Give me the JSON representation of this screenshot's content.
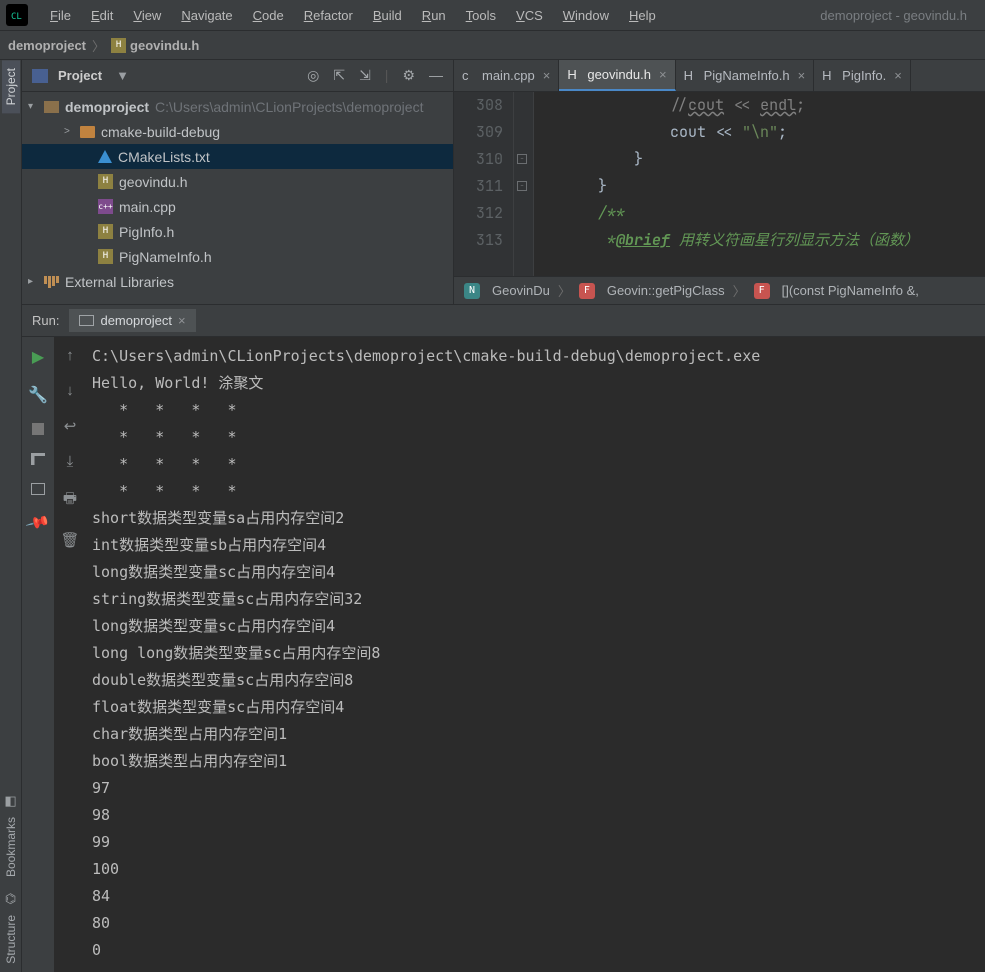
{
  "window_title": "demoproject - geovindu.h",
  "menu": [
    "File",
    "Edit",
    "View",
    "Navigate",
    "Code",
    "Refactor",
    "Build",
    "Run",
    "Tools",
    "VCS",
    "Window",
    "Help"
  ],
  "breadcrumb": {
    "project": "demoproject",
    "file": "geovindu.h"
  },
  "project_panel": {
    "title": "Project",
    "root": {
      "name": "demoproject",
      "path": "C:\\Users\\admin\\CLionProjects\\demoproject"
    },
    "items": [
      {
        "type": "folder",
        "name": "cmake-build-debug",
        "indent": 2,
        "arrow": ">"
      },
      {
        "type": "cmake",
        "name": "CMakeLists.txt",
        "indent": 3,
        "selected": true
      },
      {
        "type": "h",
        "name": "geovindu.h",
        "indent": 3
      },
      {
        "type": "cpp",
        "name": "main.cpp",
        "indent": 3
      },
      {
        "type": "h",
        "name": "PigInfo.h",
        "indent": 3
      },
      {
        "type": "h",
        "name": "PigNameInfo.h",
        "indent": 3
      }
    ],
    "ext_libs": "External Libraries"
  },
  "editor_tabs": [
    {
      "icon": "cpp",
      "label": "main.cpp",
      "active": false
    },
    {
      "icon": "h",
      "label": "geovindu.h",
      "active": true
    },
    {
      "icon": "h",
      "label": "PigNameInfo.h",
      "active": false
    },
    {
      "icon": "h",
      "label": "PigInfo.",
      "active": false
    }
  ],
  "code": {
    "lines": [
      {
        "num": 308,
        "html": "//<u class='squiggle'>cout</u> << <u class='squiggle'>endl</u>;",
        "cls": "cmt",
        "pad": "            "
      },
      {
        "num": 309,
        "html": "cout << <span class='str'>\"\\n\"</span>;",
        "cls": "",
        "pad": "            "
      },
      {
        "num": 310,
        "html": "}",
        "cls": "brace",
        "pad": "        "
      },
      {
        "num": 311,
        "html": "}",
        "cls": "brace",
        "pad": "    "
      },
      {
        "num": 312,
        "html": "/**",
        "cls": "doccmt",
        "pad": "    "
      },
      {
        "num": 313,
        "html": "*<span class='doctag'>@brief</span> 用转义符画星行列显示方法（函数）",
        "cls": "doccmt",
        "pad": "     "
      }
    ],
    "fold_marks": [
      {
        "line": 310
      },
      {
        "line": 311
      }
    ]
  },
  "editor_crumbs": [
    {
      "badge": "n",
      "label": "GeovinDu"
    },
    {
      "badge": "f",
      "label": "Geovin::getPigClass"
    },
    {
      "badge": "f",
      "label": "[](const PigNameInfo &,"
    }
  ],
  "run": {
    "label": "Run:",
    "config": "demoproject",
    "output": [
      "C:\\Users\\admin\\CLionProjects\\demoproject\\cmake-build-debug\\demoproject.exe",
      "Hello, World! 涂聚文",
      "   *   *   *   *",
      "   *   *   *   *",
      "   *   *   *   *",
      "   *   *   *   *",
      "short数据类型变量sa占用内存空间2",
      "int数据类型变量sb占用内存空间4",
      "long数据类型变量sc占用内存空间4",
      "string数据类型变量sc占用内存空间32",
      "long数据类型变量sc占用内存空间4",
      "long long数据类型变量sc占用内存空间8",
      "double数据类型变量sc占用内存空间8",
      "float数据类型变量sc占用内存空间4",
      "char数据类型占用内存空间1",
      "bool数据类型占用内存空间1",
      "97",
      "98",
      "99",
      "100",
      "84",
      "80",
      "0"
    ]
  },
  "side_labels": {
    "project": "Project",
    "bookmarks": "Bookmarks",
    "structure": "Structure"
  }
}
